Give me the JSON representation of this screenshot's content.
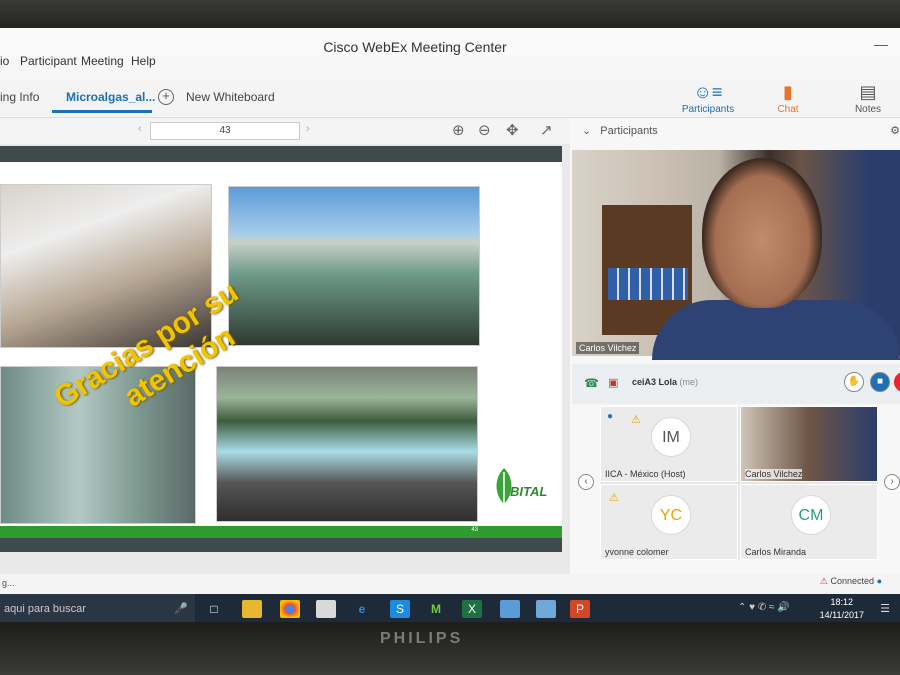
{
  "window": {
    "title": "Cisco WebEx Meeting Center"
  },
  "menu": [
    "io",
    "Participant",
    "Meeting",
    "Help"
  ],
  "tabs": [
    {
      "label": "ing Info"
    },
    {
      "label": "Microalgas_al..."
    },
    {
      "label": "New Whiteboard"
    }
  ],
  "panel_buttons": [
    {
      "label": "Participants",
      "icon": "participants-icon"
    },
    {
      "label": "Chat",
      "icon": "chat-icon"
    },
    {
      "label": "Notes",
      "icon": "notes-icon"
    }
  ],
  "toolbar": {
    "page": "43"
  },
  "slide": {
    "text_line1": "Gracias por su",
    "text_line2": "atención",
    "logo": "BITAL",
    "page_number": "43"
  },
  "participants": {
    "header": "Participants",
    "main_video_name": "Carlos Vilchez",
    "me": {
      "name": "ceiA3 Lola",
      "suffix": "(me)"
    },
    "grid": [
      {
        "initials": "IM",
        "name": "IICA - México (Host)"
      },
      {
        "initials": "",
        "name": "Carlos Vilchez"
      },
      {
        "initials": "YC",
        "name": "yvonne colomer"
      },
      {
        "initials": "CM",
        "name": "Carlos Miranda"
      }
    ]
  },
  "status": {
    "left": "g...",
    "connection": "Connected"
  },
  "taskbar": {
    "search_placeholder": "aqui para buscar",
    "time": "18:12",
    "date": "14/11/2017"
  },
  "monitor_brand": "PHILIPS"
}
